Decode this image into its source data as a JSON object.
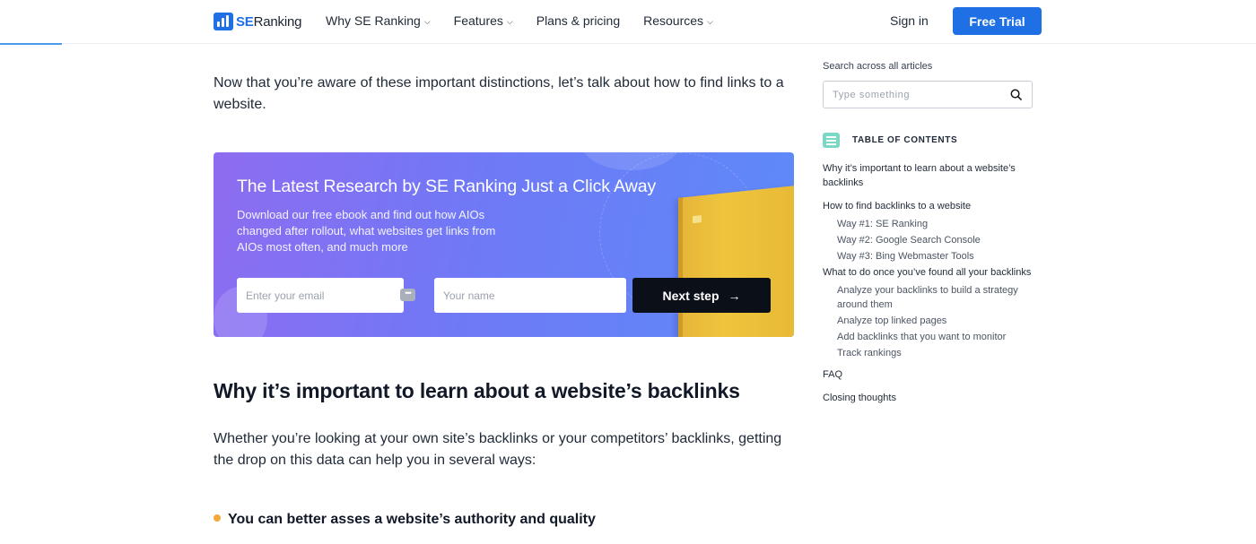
{
  "header": {
    "logo_se": "SE",
    "logo_ranking": "Ranking",
    "nav": [
      {
        "label": "Why SE Ranking",
        "has_dropdown": true
      },
      {
        "label": "Features",
        "has_dropdown": true
      },
      {
        "label": "Plans & pricing",
        "has_dropdown": false
      },
      {
        "label": "Resources",
        "has_dropdown": true
      }
    ],
    "sign_in": "Sign in",
    "free_trial": "Free Trial"
  },
  "article": {
    "intro": "Now that you’re aware of these important distinctions, let’s talk about how to find links to a website.",
    "heading": "Why it’s important to learn about a website’s backlinks",
    "paragraph": "Whether you’re looking at your own site’s backlinks or your competitors’ backlinks, getting the drop on this data can help you in several ways:",
    "bullet": "You can better asses a website’s authority and quality"
  },
  "banner": {
    "title": "The Latest Research by SE Ranking Just a Click Away",
    "description": "Download our free ebook and find out how AIOs changed after rollout, what websites get links from AIOs most often, and much more",
    "email_placeholder": "Enter your email",
    "name_placeholder": "Your name",
    "button": "Next step"
  },
  "sidebar": {
    "search_label": "Search across all articles",
    "search_placeholder": "Type something",
    "toc_title": "TABLE OF CONTENTS",
    "toc": [
      {
        "label": "Why it’s important to learn about a website’s backlinks",
        "level": 1
      },
      {
        "label": "How to find backlinks to a website",
        "level": 1
      },
      {
        "label": "Way #1: SE Ranking",
        "level": 2
      },
      {
        "label": "Way #2: Google Search Console",
        "level": 2
      },
      {
        "label": "Way #3: Bing Webmaster Tools",
        "level": 2
      },
      {
        "label": "What to do once you’ve found all your backlinks",
        "level": 1
      },
      {
        "label": "Analyze your backlinks to build a strategy around them",
        "level": 2
      },
      {
        "label": "Analyze top linked pages",
        "level": 2
      },
      {
        "label": "Add backlinks that you want to monitor",
        "level": 2
      },
      {
        "label": "Track rankings",
        "level": 2
      },
      {
        "label": "FAQ",
        "level": 1
      },
      {
        "label": "Closing thoughts",
        "level": 1
      }
    ]
  },
  "colors": {
    "brand_blue": "#1f6fe5",
    "banner_gradient_start": "#8e6cf0",
    "banner_gradient_end": "#5d8af8",
    "bullet_orange": "#f5a93c",
    "toc_icon_teal": "#7ad8c4"
  }
}
